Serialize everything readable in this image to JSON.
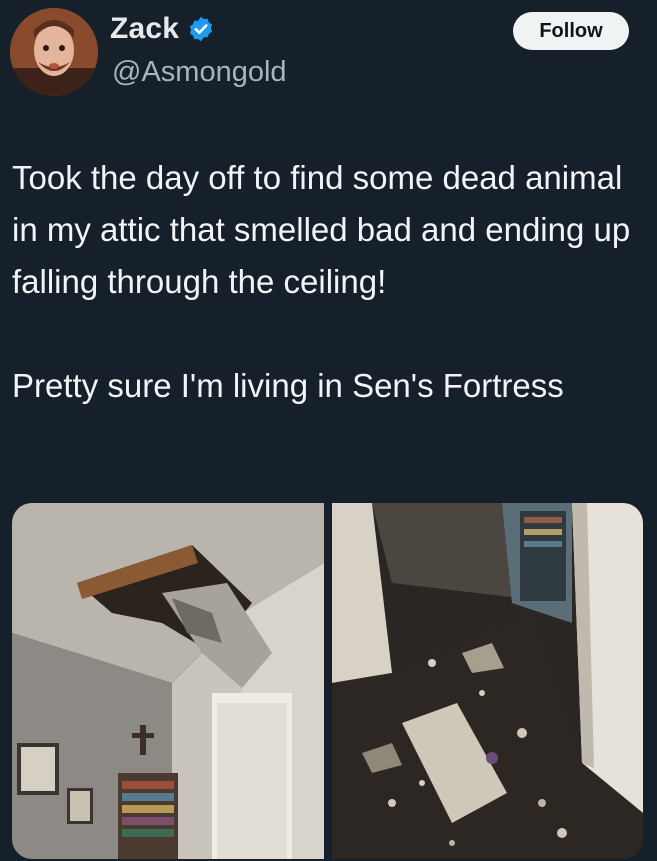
{
  "author": {
    "display_name": "Zack",
    "handle": "@Asmongold",
    "verified_icon": "verified-badge-icon",
    "avatar": "avatar-photo"
  },
  "actions": {
    "follow_label": "Follow"
  },
  "tweet": {
    "paragraphs": [
      "Took the day off to find some dead animal in my attic that smelled bad and ending up falling through the ceiling!",
      "Pretty sure I'm living in Sen's Fortress"
    ]
  },
  "media": {
    "photos": [
      {
        "description_icon": "ceiling-hole-photo"
      },
      {
        "description_icon": "debris-floor-photo"
      }
    ]
  },
  "colors": {
    "background": "#15202b",
    "text": "#e7e9ea",
    "secondary_text": "#a8b3bd",
    "verified": "#1d9bf0",
    "follow_bg": "#eff3f4"
  }
}
